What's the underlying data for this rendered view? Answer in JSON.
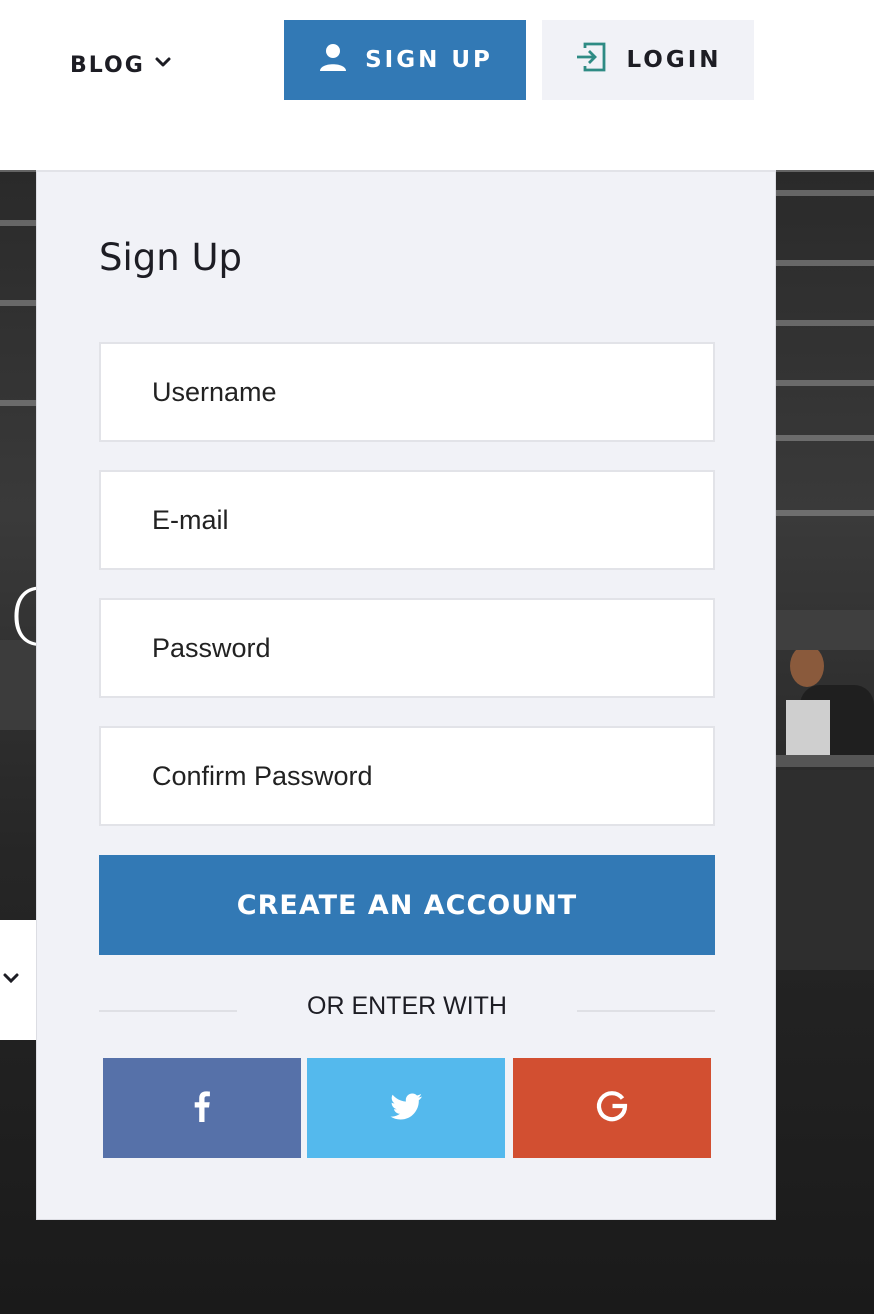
{
  "nav": {
    "blog_label": "BLOG",
    "signup_label": "SIGN UP",
    "login_label": "LOGIN"
  },
  "hero": {
    "partial_letter": "C"
  },
  "signup_form": {
    "title": "Sign Up",
    "fields": {
      "username_placeholder": "Username",
      "email_placeholder": "E-mail",
      "password_placeholder": "Password",
      "confirm_password_placeholder": "Confirm Password"
    },
    "submit_label": "CREATE AN ACCOUNT",
    "divider_text": "OR ENTER WITH",
    "social": [
      {
        "name": "facebook",
        "icon": "facebook-icon",
        "color": "#5671a9"
      },
      {
        "name": "twitter",
        "icon": "twitter-icon",
        "color": "#54b9ed"
      },
      {
        "name": "google",
        "icon": "google-icon",
        "color": "#d24f31"
      }
    ]
  },
  "colors": {
    "primary": "#3279b5",
    "panel_bg": "#f1f2f7",
    "login_icon": "#2e8b84"
  }
}
